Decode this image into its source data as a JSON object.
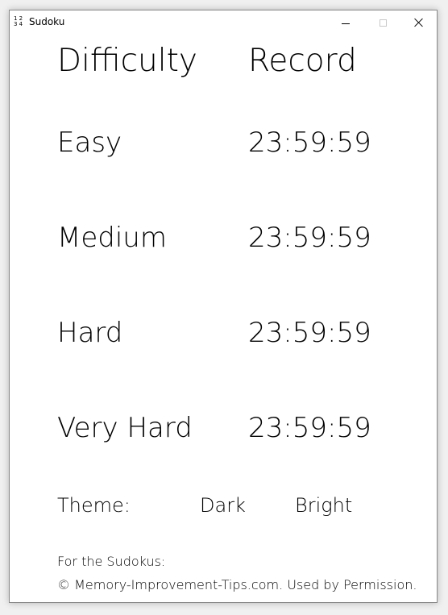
{
  "window": {
    "title": "Sudoku",
    "icon_digits": [
      "1 2",
      "3 4"
    ]
  },
  "table": {
    "header": {
      "difficulty": "Difficulty",
      "record": "Record"
    },
    "rows": [
      {
        "difficulty": "Easy",
        "record": "23:59:59"
      },
      {
        "difficulty": "Medium",
        "record": "23:59:59"
      },
      {
        "difficulty": "Hard",
        "record": "23:59:59"
      },
      {
        "difficulty": "Very Hard",
        "record": "23:59:59"
      }
    ]
  },
  "theme": {
    "label": "Theme:",
    "options": [
      "Dark",
      "Bright"
    ]
  },
  "credits": {
    "line1": "For the Sudokus:",
    "line2": "© Memory-Improvement-Tips.com. Used by Permission."
  }
}
